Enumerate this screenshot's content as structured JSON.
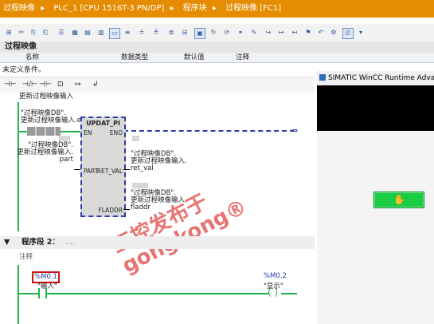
{
  "breadcrumb": [
    "过程映像",
    "PLC_1 [CPU 1516T-3 PN/DP]",
    "程序块",
    "过程映像 [FC1]"
  ],
  "breadcrumb_sep": "▸",
  "interface": {
    "title": "过程映像",
    "columns": [
      "名称",
      "数据类型",
      "默认值",
      "注释"
    ],
    "undefined_condition": "未定义条件。"
  },
  "ladder_toolbar": [
    "⊣⊢",
    "⊣/⊢",
    "⊣⊢",
    "⊡",
    "↦",
    "↲"
  ],
  "network1": {
    "title": "更新过程映像输入",
    "en_contact_label": "\"过程映像DB\".\n更新过程映像输入.en",
    "block": {
      "name": "UPDAT_PI",
      "en": "EN",
      "eno": "ENO",
      "part": "PART",
      "ret_val": "RET_VAL",
      "fladdr": "FLADDR"
    },
    "part_label": "\"过程映像DB\".\n更新过程映像输入.\npart",
    "ret_val_label": "\"过程映像DB\".\n更新过程映像输入.\nret_val",
    "fladdr_label": "\"过程映像DB\".\n更新过程映像输入.\nfladdr"
  },
  "segment2": {
    "title": "程序段 2：",
    "dots": "....",
    "comment": "注释"
  },
  "network2": {
    "input_address": "%M0.1",
    "input_name": "\"输入\"",
    "output_address": "%M0.2",
    "output_name": "\"显示\""
  },
  "wincc": {
    "title": "SIMATIC WinCC Runtime Advanced"
  },
  "watermark": "工控发布于\ngongkong®",
  "colors": {
    "breadcrumb_bg": "#e58c00",
    "wire": "#22b24c",
    "dashed": "#2b3ba8",
    "highlight": "#d01010",
    "wincc_button": "#19cc44"
  }
}
